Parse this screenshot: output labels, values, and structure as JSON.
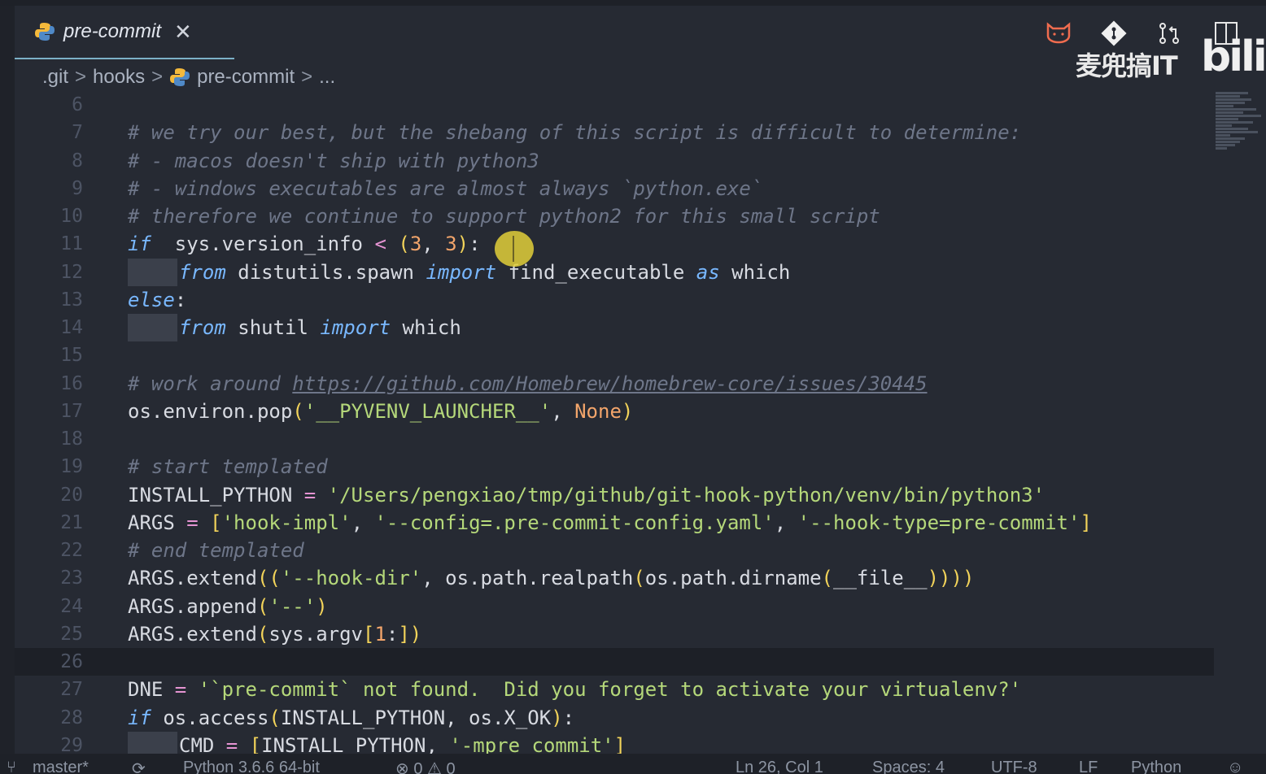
{
  "tab": {
    "label": "pre-commit",
    "close": "✕"
  },
  "breadcrumb": {
    "items": [
      ".git",
      "hooks",
      "pre-commit",
      "..."
    ]
  },
  "watermark": {
    "text": "麦兜搞IT",
    "brand": "bili"
  },
  "cursor_color": "#e2cf3a",
  "code": {
    "lines": [
      {
        "n": "6",
        "segs": []
      },
      {
        "n": "7",
        "segs": [
          [
            "cm",
            "# we try our best, but the shebang of this script is difficult to determine:"
          ]
        ]
      },
      {
        "n": "8",
        "segs": [
          [
            "cm",
            "# - macos doesn't ship with python3"
          ]
        ]
      },
      {
        "n": "9",
        "segs": [
          [
            "cm",
            "# - windows executables are almost always `python.exe`"
          ]
        ]
      },
      {
        "n": "10",
        "segs": [
          [
            "cm",
            "# therefore we continue to support python2 for this small script"
          ]
        ]
      },
      {
        "n": "11",
        "segs": [
          [
            "kw",
            "if"
          ],
          [
            "",
            "  sys.version_info "
          ],
          [
            "op",
            "<"
          ],
          [
            "",
            " "
          ],
          [
            "br",
            "("
          ],
          [
            "nm",
            "3"
          ],
          [
            "",
            ", "
          ],
          [
            "nm",
            "3"
          ],
          [
            "br",
            ")"
          ],
          [
            "",
            ":"
          ]
        ]
      },
      {
        "n": "12",
        "indent": 1,
        "segs": [
          [
            "kw",
            "from"
          ],
          [
            "",
            " distutils.spawn "
          ],
          [
            "kw",
            "import"
          ],
          [
            "",
            " find_executable "
          ],
          [
            "kw",
            "as"
          ],
          [
            "",
            " which"
          ]
        ]
      },
      {
        "n": "13",
        "segs": [
          [
            "kw",
            "else"
          ],
          [
            "",
            ":"
          ]
        ]
      },
      {
        "n": "14",
        "indent": 1,
        "segs": [
          [
            "kw",
            "from"
          ],
          [
            "",
            " shutil "
          ],
          [
            "kw",
            "import"
          ],
          [
            "",
            " which"
          ]
        ]
      },
      {
        "n": "15",
        "segs": []
      },
      {
        "n": "16",
        "segs": [
          [
            "cm",
            "# work around "
          ],
          [
            "cm un",
            "https://github.com/Homebrew/homebrew-core/issues/30445"
          ]
        ]
      },
      {
        "n": "17",
        "segs": [
          [
            "",
            "os.environ.pop"
          ],
          [
            "br",
            "("
          ],
          [
            "st",
            "'__PYVENV_LAUNCHER__'"
          ],
          [
            "",
            ", "
          ],
          [
            "nm",
            "None"
          ],
          [
            "br",
            ")"
          ]
        ]
      },
      {
        "n": "18",
        "segs": []
      },
      {
        "n": "19",
        "segs": [
          [
            "cm",
            "# start templated"
          ]
        ]
      },
      {
        "n": "20",
        "segs": [
          [
            "",
            "INSTALL_PYTHON "
          ],
          [
            "op",
            "="
          ],
          [
            "",
            " "
          ],
          [
            "st",
            "'/Users/pengxiao/tmp/github/git-hook-python/venv/bin/python3'"
          ]
        ]
      },
      {
        "n": "21",
        "segs": [
          [
            "",
            "ARGS "
          ],
          [
            "op",
            "="
          ],
          [
            "",
            " "
          ],
          [
            "br",
            "["
          ],
          [
            "st",
            "'hook-impl'"
          ],
          [
            "",
            ", "
          ],
          [
            "st",
            "'--config=.pre-commit-config.yaml'"
          ],
          [
            "",
            ", "
          ],
          [
            "st",
            "'--hook-type=pre-commit'"
          ],
          [
            "br",
            "]"
          ]
        ]
      },
      {
        "n": "22",
        "segs": [
          [
            "cm",
            "# end templated"
          ]
        ]
      },
      {
        "n": "23",
        "segs": [
          [
            "",
            "ARGS.extend"
          ],
          [
            "br",
            "(("
          ],
          [
            "st",
            "'--hook-dir'"
          ],
          [
            "",
            ", os.path.realpath"
          ],
          [
            "br",
            "("
          ],
          [
            "",
            "os.path.dirname"
          ],
          [
            "br",
            "("
          ],
          [
            "",
            "__file__"
          ],
          [
            "br",
            "))))"
          ]
        ]
      },
      {
        "n": "24",
        "segs": [
          [
            "",
            "ARGS.append"
          ],
          [
            "br",
            "("
          ],
          [
            "st",
            "'--'"
          ],
          [
            "br",
            ")"
          ]
        ]
      },
      {
        "n": "25",
        "segs": [
          [
            "",
            "ARGS.extend"
          ],
          [
            "br",
            "("
          ],
          [
            "",
            "sys.argv"
          ],
          [
            "br",
            "["
          ],
          [
            "nm",
            "1"
          ],
          [
            "",
            ":"
          ],
          [
            "br",
            "])"
          ]
        ]
      },
      {
        "n": "26",
        "current": true,
        "segs": []
      },
      {
        "n": "27",
        "segs": [
          [
            "",
            "DNE "
          ],
          [
            "op",
            "="
          ],
          [
            "",
            " "
          ],
          [
            "st",
            "'`pre-commit` not found.  Did you forget to activate your virtualenv?'"
          ]
        ]
      },
      {
        "n": "28",
        "segs": [
          [
            "kw",
            "if"
          ],
          [
            "",
            " os.access"
          ],
          [
            "br",
            "("
          ],
          [
            "",
            "INSTALL_PYTHON, os.X_OK"
          ],
          [
            "br",
            ")"
          ],
          [
            "",
            ":"
          ]
        ]
      },
      {
        "n": "29",
        "indent": 1,
        "segs": [
          [
            "",
            "CMD "
          ],
          [
            "op",
            "="
          ],
          [
            "",
            " "
          ],
          [
            "br",
            "["
          ],
          [
            "",
            "INSTALL_PYTHON, "
          ],
          [
            "st",
            "'-mpre_commit'"
          ],
          [
            "br",
            "]"
          ]
        ]
      }
    ]
  },
  "status": {
    "branch": "master*",
    "sync_icon": "sync-icon",
    "interpreter": "Python 3.6.6 64-bit",
    "problems": "⊗ 0 ⚠ 0",
    "position": "Ln 26, Col 1",
    "spaces": "Spaces: 4",
    "encoding": "UTF-8",
    "eol": "LF",
    "language": "Python"
  }
}
